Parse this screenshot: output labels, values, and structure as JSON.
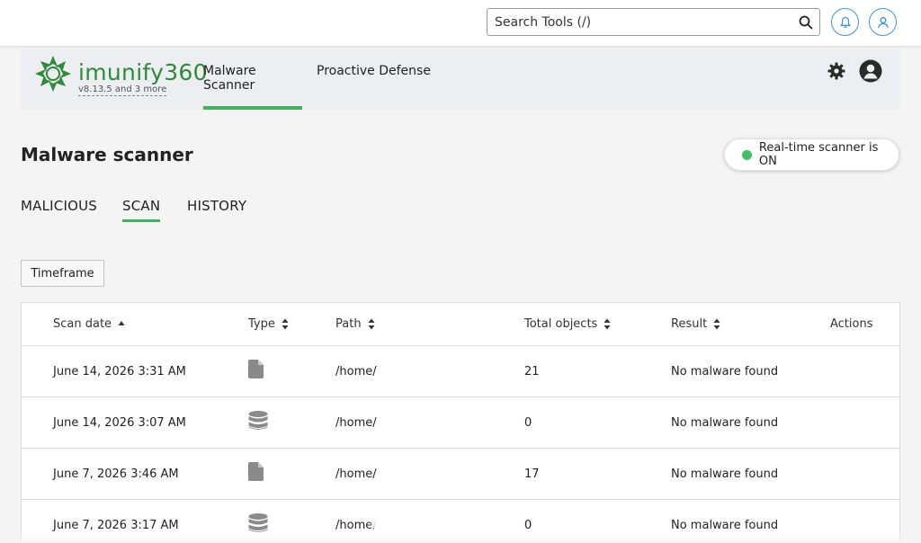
{
  "topbar": {
    "search_placeholder": "Search Tools (/)",
    "search_value": ""
  },
  "app": {
    "logo_word": "imunify",
    "logo_number": "360",
    "version_text": "v8.13.5 and 3 more",
    "nav": [
      {
        "label": "Malware Scanner",
        "active": true
      },
      {
        "label": "Proactive Defense",
        "active": false
      }
    ],
    "brand_color": "#2e8b3b",
    "accent_color": "#43b05c"
  },
  "page": {
    "title": "Malware scanner",
    "realtime_status": "Real-time scanner is ON",
    "status_color": "#43c063",
    "tabs": [
      {
        "label": "MALICIOUS",
        "active": false
      },
      {
        "label": "SCAN",
        "active": true
      },
      {
        "label": "HISTORY",
        "active": false
      }
    ],
    "timeframe_label": "Timeframe"
  },
  "table": {
    "columns": [
      "Scan date",
      "Type",
      "Path",
      "Total objects",
      "Result",
      "Actions"
    ],
    "rows": [
      {
        "date": "June 14, 2026 3:31 AM",
        "type_icon": "file-icon",
        "path": "/home/",
        "total": "21",
        "result": "No malware found"
      },
      {
        "date": "June 14, 2026 3:07 AM",
        "type_icon": "database-icon",
        "path": "/home/",
        "total": "0",
        "result": "No malware found"
      },
      {
        "date": "June 7, 2026 3:46 AM",
        "type_icon": "file-icon",
        "path": "/home/",
        "total": "17",
        "result": "No malware found"
      },
      {
        "date": "June 7, 2026 3:17 AM",
        "type_icon": "database-icon",
        "path": "/home/",
        "total": "0",
        "result": "No malware found"
      }
    ]
  }
}
